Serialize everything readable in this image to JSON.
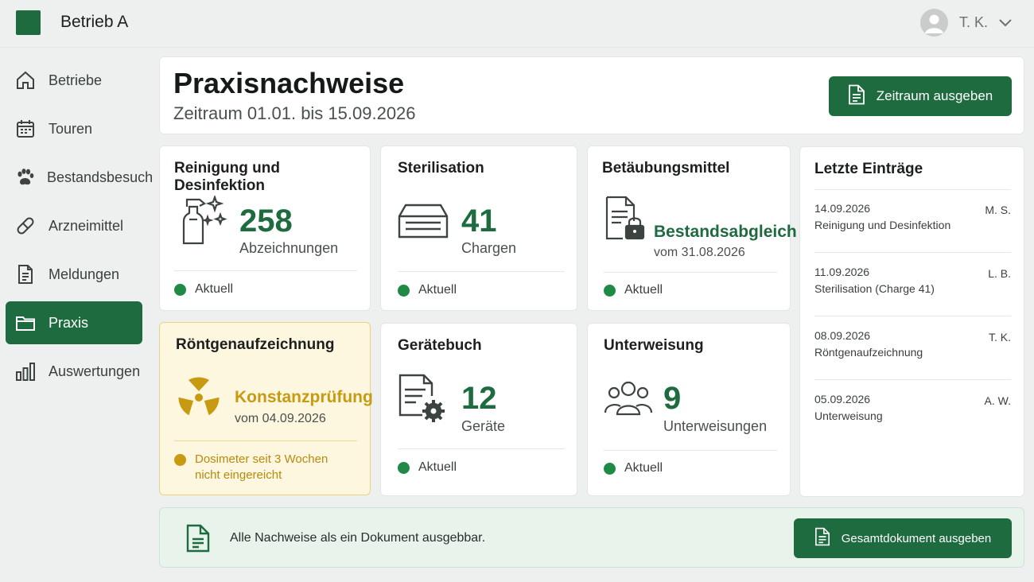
{
  "header": {
    "org_name": "Betrieb A",
    "user_name": "T. K."
  },
  "sidebar": {
    "items": [
      {
        "label": "Betriebe",
        "icon": "home-icon"
      },
      {
        "label": "Touren",
        "icon": "calendar-icon"
      },
      {
        "label": "Bestandsbesuch",
        "icon": "paw-icon"
      },
      {
        "label": "Arzneimittel",
        "icon": "pill-icon"
      },
      {
        "label": "Meldungen",
        "icon": "document-icon"
      },
      {
        "label": "Praxis",
        "icon": "folder-icon",
        "active": true
      },
      {
        "label": "Auswertungen",
        "icon": "bar-chart-icon"
      }
    ]
  },
  "page": {
    "title": "Praxisnachweise",
    "subtitle": "Zeitraum 01.01. bis 15.09.2026",
    "export_range_label": "Zeitraum ausgeben"
  },
  "cards": {
    "reinigung": {
      "title": "Reinigung und Desinfektion",
      "value": "258",
      "unit": "Abzeichnungen",
      "status": "Aktuell"
    },
    "sterilisation": {
      "title": "Sterilisation",
      "value": "41",
      "unit": "Chargen",
      "status": "Aktuell"
    },
    "btm": {
      "title": "Betäubungsmittel",
      "value": "Bestandsabgleich",
      "unit": "vom 31.08.2026",
      "status": "Aktuell"
    },
    "roentgen": {
      "title": "Röntgenaufzeichnung",
      "value": "Konstanzprüfung",
      "unit": "vom 04.09.2026",
      "warning_line1": "Dosimeter seit 3 Wochen",
      "warning_line2": "nicht eingereicht"
    },
    "geraete": {
      "title": "Gerätebuch",
      "value": "12",
      "unit": "Geräte",
      "status": "Aktuell"
    },
    "unterweisung": {
      "title": "Unterweisung",
      "value": "9",
      "unit": "Unterweisungen",
      "status": "Aktuell"
    }
  },
  "recent": {
    "title": "Letzte Einträge",
    "items": [
      {
        "date": "14.09.2026",
        "label": "Reinigung und Desinfektion",
        "initials": "M. S."
      },
      {
        "date": "11.09.2026",
        "label": "Sterilisation (Charge 41)",
        "initials": "L. B."
      },
      {
        "date": "08.09.2026",
        "label": "Röntgenaufzeichnung",
        "initials": "T. K."
      },
      {
        "date": "05.09.2026",
        "label": "Unterweisung",
        "initials": "A. W."
      }
    ]
  },
  "footer": {
    "text": "Alle Nachweise als ein Dokument ausgebbar.",
    "button_label": "Gesamtdokument ausgeben"
  },
  "colors": {
    "brand": "#1d6b3f",
    "ok": "#1f8a46",
    "warning": "#c79a12"
  }
}
